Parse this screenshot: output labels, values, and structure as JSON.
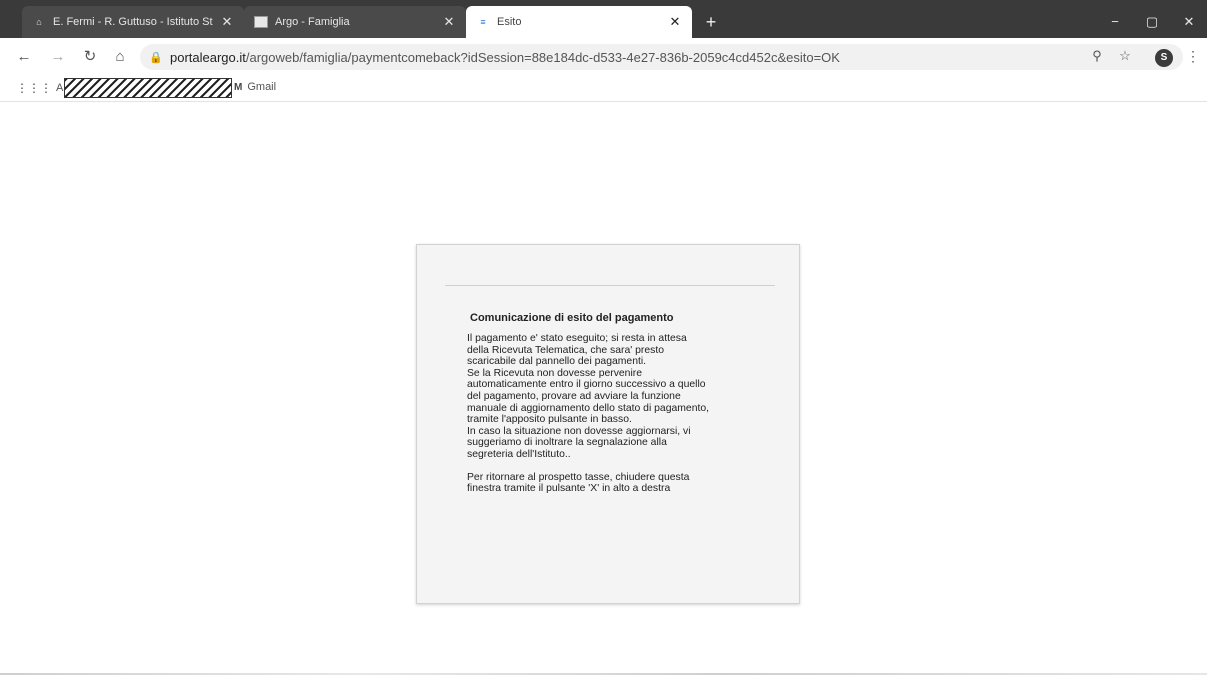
{
  "browser": {
    "tabs": [
      {
        "title": "E. Fermi - R. Guttuso - Istituto St",
        "favicon": "school-favicon",
        "active": false
      },
      {
        "title": "Argo - Famiglia",
        "favicon": "argo-favicon",
        "active": false
      },
      {
        "title": "Esito",
        "favicon": "page-favicon",
        "active": true
      }
    ],
    "new_tab": "+",
    "address": {
      "host": "portaleargo.it",
      "path": "/argoweb/famiglia/paymentcomeback?idSession=88e184dc-d533-4e27-836b-2059c4cd452c&esito=OK"
    },
    "profile_initial": "S",
    "bookmarks": {
      "apps_label": "App",
      "gmail_label": "Gmail"
    }
  },
  "dialog": {
    "title": "Comunicazione di esito del pagamento",
    "lines_1": [
      "Il pagamento e' stato eseguito; si resta in attesa",
      "della Ricevuta Telematica, che sara' presto",
      "scaricabile dal pannello dei pagamenti.",
      "Se la Ricevuta non dovesse pervenire",
      "automaticamente entro il giorno successivo a quello",
      "del pagamento, provare ad avviare la funzione",
      "manuale di aggiornamento dello stato di pagamento,",
      "tramite l'apposito pulsante in basso.",
      "In caso la situazione non dovesse aggiornarsi, vi",
      "suggeriamo di inoltrare la segnalazione alla",
      "segreteria dell'Istituto.."
    ],
    "lines_2": [
      "Per ritornare al prospetto tasse, chiudere questa",
      "finestra tramite il pulsante 'X' in alto a destra"
    ]
  }
}
